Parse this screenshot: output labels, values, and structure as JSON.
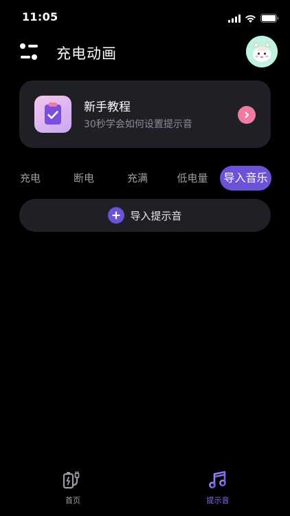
{
  "status_bar": {
    "time": "11:05"
  },
  "header": {
    "title": "充电动画"
  },
  "tutorial": {
    "title": "新手教程",
    "subtitle": "30秒学会如何设置提示音"
  },
  "tabs": [
    {
      "label": "充电",
      "active": false
    },
    {
      "label": "断电",
      "active": false
    },
    {
      "label": "充满",
      "active": false
    },
    {
      "label": "低电量",
      "active": false
    },
    {
      "label": "导入音乐",
      "active": true
    }
  ],
  "import_button": {
    "label": "导入提示音"
  },
  "bottom_nav": {
    "items": [
      {
        "label": "首页",
        "icon": "battery-plug-icon",
        "active": false
      },
      {
        "label": "提示音",
        "icon": "music-note-icon",
        "active": true
      }
    ]
  },
  "colors": {
    "background": "#000000",
    "card": "#1f1f25",
    "accent": "#6b52d6",
    "arrow": "#f27aa0",
    "muted_text": "#8c8c95"
  }
}
